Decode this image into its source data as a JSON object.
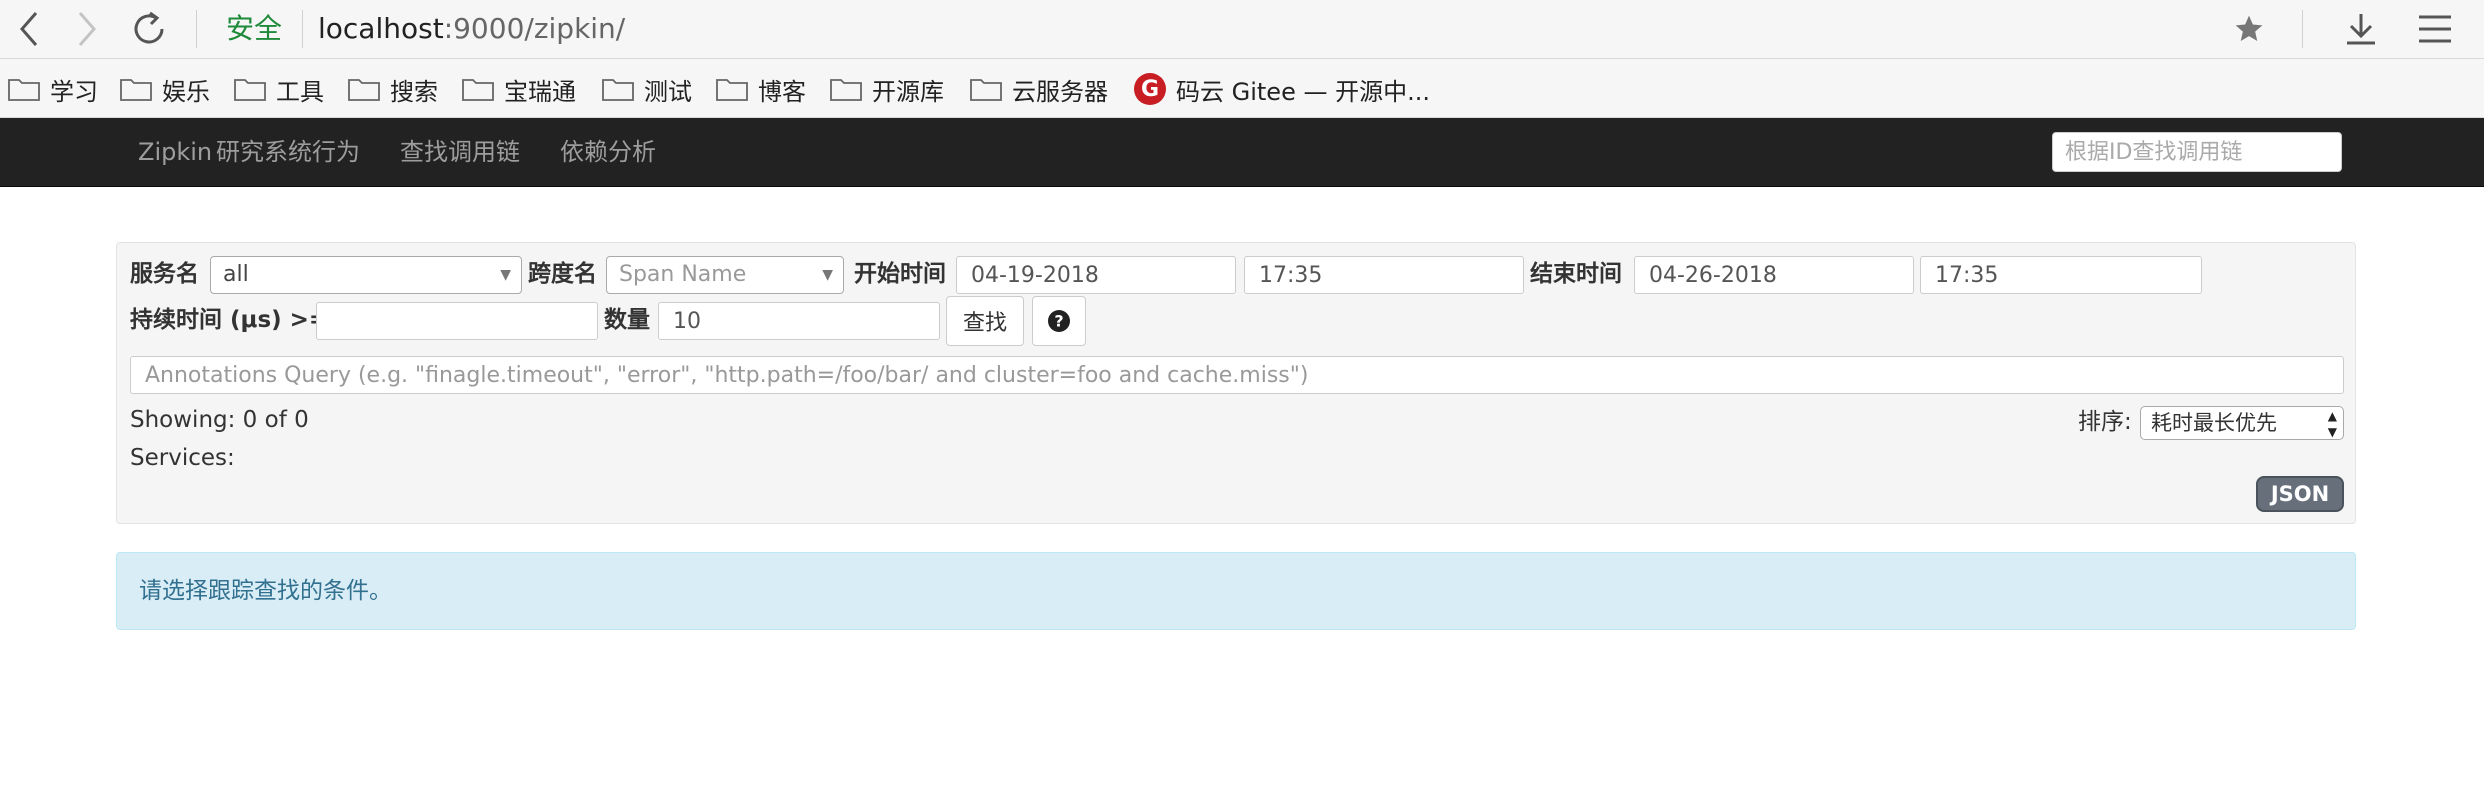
{
  "browser": {
    "secure_label": "安全",
    "url_host": "localhost",
    "url_rest": ":9000/zipkin/",
    "icons": [
      "back-icon",
      "forward-icon",
      "reload-icon",
      "star-icon",
      "download-icon",
      "menu-icon"
    ]
  },
  "bookmarks": [
    {
      "label": "学习"
    },
    {
      "label": "娱乐"
    },
    {
      "label": "工具"
    },
    {
      "label": "搜索"
    },
    {
      "label": "宝瑞通"
    },
    {
      "label": "测试"
    },
    {
      "label": "博客"
    },
    {
      "label": "开源库"
    },
    {
      "label": "云服务器"
    },
    {
      "label": "码云 Gitee — 开源中..."
    }
  ],
  "navbar": {
    "brand": "Zipkin",
    "links": [
      "研究系统行为",
      "查找调用链",
      "依赖分析"
    ],
    "trace_id_placeholder": "根据ID查找调用链"
  },
  "search": {
    "service_label": "服务名",
    "service_value": "all",
    "span_label": "跨度名",
    "span_placeholder": "Span Name",
    "start_label": "开始时间",
    "start_date": "04-19-2018",
    "start_time": "17:35",
    "end_label": "结束时间",
    "end_date": "04-26-2018",
    "end_time": "17:35",
    "duration_label": "持续时间 (μs) >=",
    "duration_value": "",
    "limit_label": "数量",
    "limit_value": "10",
    "find_button": "查找",
    "help_icon": "question-circle-icon",
    "annotations_placeholder": "Annotations Query (e.g. \"finagle.timeout\", \"error\", \"http.path=/foo/bar/ and cluster=foo and cache.miss\")",
    "showing": "Showing: 0 of 0",
    "services": "Services:",
    "sort_label": "排序:",
    "sort_value": "耗时最长优先",
    "json_button": "JSON"
  },
  "alert": {
    "message": "请选择跟踪查找的条件。"
  },
  "colors": {
    "navbar_bg": "#222222",
    "navbar_text": "#9d9d9d",
    "secure_green": "#1f8a3a",
    "alert_bg": "#d9edf7",
    "alert_text": "#31708f",
    "gitee_red": "#c71d23"
  }
}
